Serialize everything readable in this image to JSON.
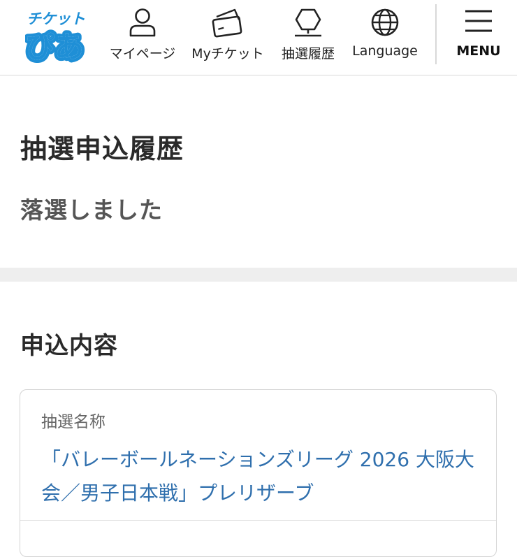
{
  "header": {
    "logo": {
      "line1": "チケット",
      "line2": "ぴあ",
      "color": "#1f8fd6"
    },
    "nav": [
      {
        "label": "マイページ",
        "icon": "person-icon"
      },
      {
        "label": "Myチケット",
        "icon": "ticket-icon"
      },
      {
        "label": "抽選履歴",
        "icon": "lottery-icon"
      },
      {
        "label": "Language",
        "icon": "globe-icon"
      }
    ],
    "menu": {
      "label": "MENU",
      "icon": "hamburger-icon"
    }
  },
  "page": {
    "title": "抽選申込履歴",
    "result": "落選しました"
  },
  "application": {
    "heading": "申込内容",
    "lottery_name_label": "抽選名称",
    "lottery_name_value": "「バレーボールネーションズリーグ 2026 大阪大会／男子日本戦」プレリザーブ"
  },
  "colors": {
    "link": "#2f6fad",
    "band": "#eeeeee",
    "brand": "#1f8fd6"
  }
}
